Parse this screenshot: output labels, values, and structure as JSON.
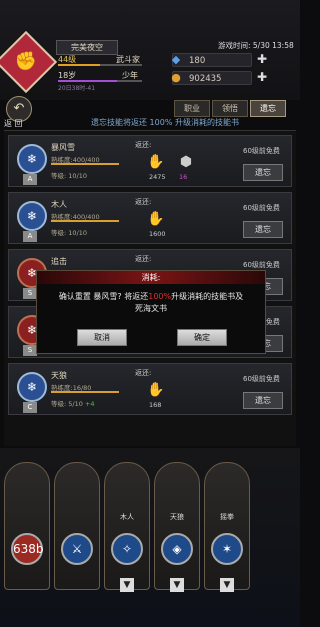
{
  "player": {
    "name": "完美夜空",
    "level": "44级",
    "job": "武斗家",
    "age": "18岁",
    "stage": "少年",
    "bar_text": "20日38时-41",
    "exp": 0.5,
    "age_progress": 0.7
  },
  "header": {
    "clock": "游戏时间: 5/30 13:58"
  },
  "resources": [
    {
      "icon": "gem-icon",
      "value": "180"
    },
    {
      "icon": "coin-icon",
      "value": "902435"
    }
  ],
  "tabs": [
    "职业",
    "领悟",
    "遗忘"
  ],
  "back_label": "返 回",
  "banner": "遗忘技能将返还 100% 升级消耗的技能书",
  "skills": [
    {
      "name": "暴风雪",
      "prof": "熟练度:400/400",
      "level": "等级: 10/10",
      "tag": "A",
      "ret": "返还:",
      "mats": [
        {
          "icon": "✋",
          "count": "2475"
        },
        {
          "icon": "⬢",
          "count": "16"
        }
      ],
      "free": "60级前免费",
      "forget": "遗忘",
      "color": "blue"
    },
    {
      "name": "木人",
      "prof": "熟练度:400/400",
      "level": "等级: 10/10",
      "tag": "A",
      "ret": "返还:",
      "mats": [
        {
          "icon": "✋",
          "count": "1600"
        }
      ],
      "free": "60级前免费",
      "forget": "遗忘",
      "color": "blue"
    },
    {
      "name": "追击",
      "prof": "",
      "level": "",
      "tag": "S",
      "ret": "返还:",
      "mats": [],
      "free": "60级前免费",
      "forget": "遗忘",
      "color": "red"
    },
    {
      "name": "",
      "prof": "",
      "level": "",
      "tag": "S",
      "ret": "",
      "mats": [],
      "free": "60级前免费",
      "forget": "遗忘",
      "color": "red"
    },
    {
      "name": "天狼",
      "prof": "熟练度:16/80",
      "level": "等级: 5/10",
      "level_bonus": "+4",
      "tag": "C",
      "ret": "返还:",
      "mats": [
        {
          "icon": "✋",
          "count": "168"
        }
      ],
      "free": "60级前免费",
      "forget": "遗忘",
      "color": "blue"
    }
  ],
  "dialog": {
    "title": "消耗:",
    "msg_a": "确认重置 暴风雪? 将返还",
    "msg_pct": "100%",
    "msg_b": "升级消耗的技能书及死海文书",
    "cancel": "取消",
    "confirm": "确定"
  },
  "equip": [
    {
      "label": "",
      "circle": "638b",
      "circle_color": "#9a2a22"
    },
    {
      "label": "",
      "circle": "⚔",
      "circle_color": "#1f4a8a"
    },
    {
      "label": "木人",
      "circle": "✧",
      "circle_color": "#1f4a8a"
    },
    {
      "label": "天狼",
      "circle": "◈",
      "circle_color": "#1f4a8a"
    },
    {
      "label": "摇拳",
      "circle": "✶",
      "circle_color": "#1f4a8a"
    }
  ]
}
